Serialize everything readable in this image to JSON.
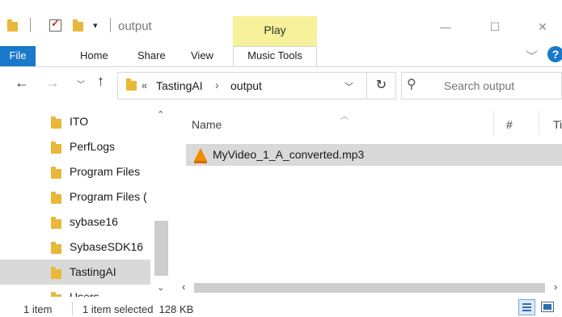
{
  "window": {
    "title": "output",
    "context_tab": "Play",
    "controls": {
      "minimize": "—",
      "maximize": "☐",
      "close": "✕"
    }
  },
  "quick_access": {
    "dropdown": "▾"
  },
  "ribbon": {
    "tabs": [
      "File",
      "Home",
      "Share",
      "View",
      "Music Tools"
    ],
    "collapse": "﹀",
    "help": "?"
  },
  "address": {
    "overflow": "«",
    "crumbs": [
      "TastingAI",
      "output"
    ],
    "separator": "›",
    "dropdown": "﹀",
    "refresh": "↻"
  },
  "nav": {
    "back": "←",
    "forward": "→",
    "recent": "﹀",
    "up": "↑"
  },
  "search": {
    "placeholder": "Search output"
  },
  "nav_pane": {
    "items": [
      "ITO",
      "PerfLogs",
      "Program Files",
      "Program Files (",
      "sybase16",
      "SybaseSDK16",
      "TastingAI",
      "Users"
    ],
    "selected": "TastingAI",
    "scroll_up": "⌃",
    "scroll_down": "⌄"
  },
  "columns": {
    "sort_indicator": "︿",
    "name": "Name",
    "number": "#",
    "title": "Ti"
  },
  "files": [
    {
      "name": "MyVideo_1_A_converted.mp3",
      "icon": "vlc-cone-icon"
    }
  ],
  "hscroll": {
    "left": "‹",
    "right": "›"
  },
  "status": {
    "count": "1 item",
    "selection": "1 item selected  128 KB"
  },
  "colors": {
    "accent": "#1979ca",
    "context_tab": "#f6f19a",
    "folder": "#e8b83a",
    "selection": "#d9d9d9"
  }
}
